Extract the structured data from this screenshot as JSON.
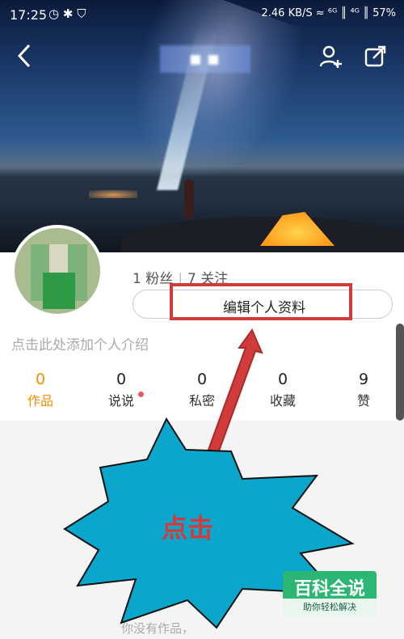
{
  "status_bar": {
    "time": "17:25",
    "left_icons": "◷ ✱ ⛉",
    "right_text": "2.46 KB/S  ≈  ⁶ᴳ ║ ⁴ᴳ ║  57%"
  },
  "header": {
    "back_icon": "chevron-left",
    "add_friend_icon": "person-add",
    "share_icon": "share"
  },
  "profile": {
    "fans": "1 粉丝",
    "following": "7 关注",
    "edit_button": "编辑个人资料",
    "intro_placeholder": "点击此处添加个人介绍"
  },
  "stats": [
    {
      "num": "0",
      "label": "作品",
      "active": true
    },
    {
      "num": "0",
      "label": "说说",
      "active": false
    },
    {
      "num": "0",
      "label": "私密",
      "active": false
    },
    {
      "num": "0",
      "label": "收藏",
      "active": false
    },
    {
      "num": "9",
      "label": "赞",
      "active": false
    }
  ],
  "annotation": {
    "callout_text": "点击",
    "highlight_color": "#d23b3b",
    "burst_color": "#0aa6cc"
  },
  "empty_state": "你没有作品，",
  "watermark": {
    "title": "百科全说",
    "subtitle": "助你轻松解决"
  }
}
